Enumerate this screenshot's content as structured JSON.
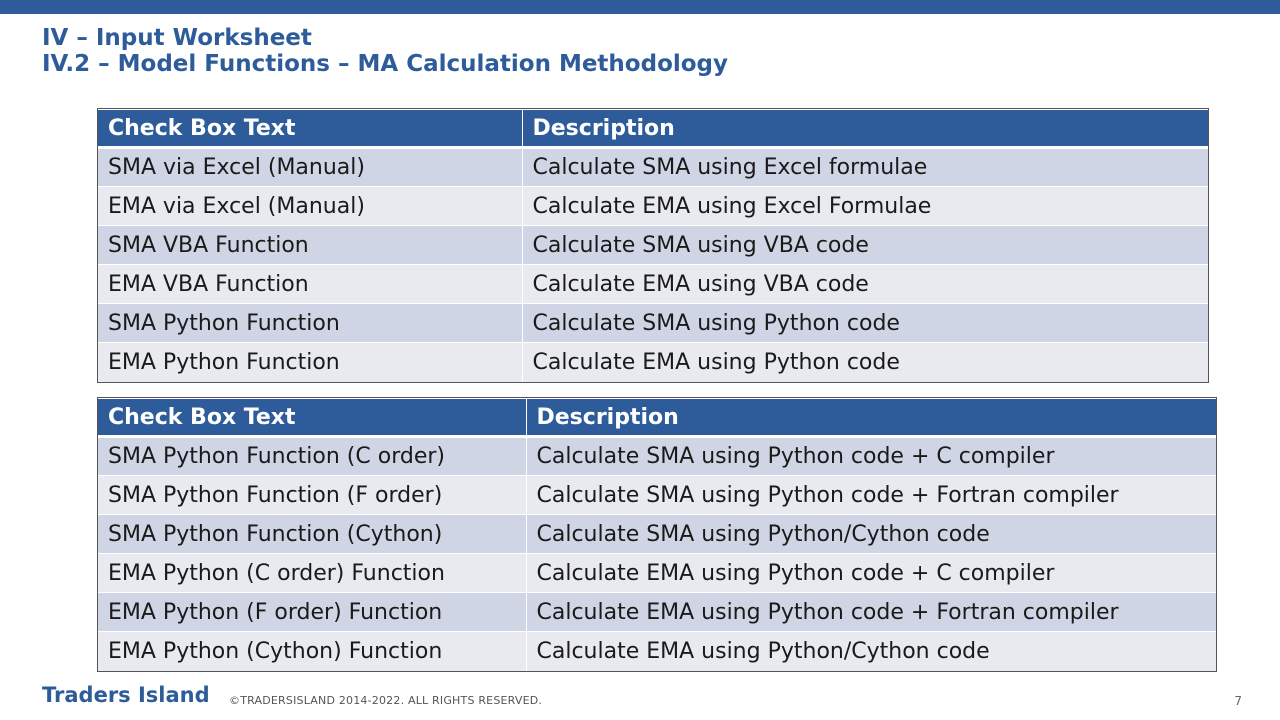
{
  "header": {
    "title_line1": "IV – Input Worksheet",
    "title_line2": "IV.2 – Model Functions – MA Calculation Methodology"
  },
  "table1": {
    "headers": [
      "Check Box Text",
      "Description"
    ],
    "rows": [
      [
        "SMA via Excel (Manual)",
        "Calculate SMA using Excel formulae"
      ],
      [
        "EMA via Excel (Manual)",
        "Calculate EMA using Excel Formulae"
      ],
      [
        "SMA VBA Function",
        "Calculate SMA using VBA code"
      ],
      [
        "EMA VBA Function",
        "Calculate EMA using VBA code"
      ],
      [
        "SMA Python Function",
        "Calculate SMA using Python code"
      ],
      [
        "EMA Python Function",
        "Calculate EMA using Python code"
      ]
    ]
  },
  "table2": {
    "headers": [
      "Check Box Text",
      "Description"
    ],
    "rows": [
      [
        "SMA Python Function (C order)",
        "Calculate SMA using Python code + C compiler"
      ],
      [
        "SMA Python Function (F order)",
        "Calculate SMA using Python code + Fortran compiler"
      ],
      [
        "SMA Python Function (Cython)",
        "Calculate SMA using Python/Cython code"
      ],
      [
        "EMA Python (C order) Function",
        "Calculate EMA using Python code + C compiler"
      ],
      [
        "EMA Python (F order) Function",
        "Calculate EMA using Python code + Fortran compiler"
      ],
      [
        "EMA Python (Cython) Function",
        "Calculate EMA using Python/Cython code"
      ]
    ]
  },
  "footer": {
    "brand": "Traders Island",
    "copyright": "©TRADERSISLAND 2014-2022. ALL RIGHTS RESERVED.",
    "page_number": "7"
  },
  "colors": {
    "accent": "#2E5C9A",
    "row_odd": "#CFD5E4",
    "row_even": "#E8EAF0"
  }
}
